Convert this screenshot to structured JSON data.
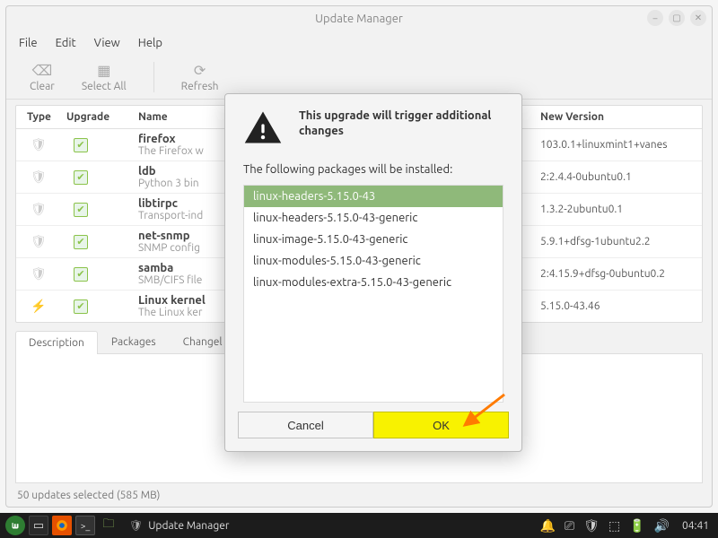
{
  "window": {
    "title": "Update Manager"
  },
  "menubar": {
    "file": "File",
    "edit": "Edit",
    "view": "View",
    "help": "Help"
  },
  "toolbar": {
    "clear": "Clear",
    "select_all": "Select All",
    "refresh": "Refresh"
  },
  "table_header": {
    "type": "Type",
    "upgrade": "Upgrade",
    "name": "Name",
    "new_version": "New Version"
  },
  "packages": [
    {
      "name": "firefox",
      "desc": "The Firefox w",
      "version": "103.0.1+linuxmint1+vanes",
      "icon": "shield"
    },
    {
      "name": "ldb",
      "desc": "Python 3 bin",
      "version": "2:2.4.4-0ubuntu0.1",
      "icon": "shield"
    },
    {
      "name": "libtirpc",
      "desc": "Transport-ind",
      "version": "1.3.2-2ubuntu0.1",
      "icon": "shield"
    },
    {
      "name": "net-snmp",
      "desc": "SNMP config",
      "version": "5.9.1+dfsg-1ubuntu2.2",
      "icon": "shield"
    },
    {
      "name": "samba",
      "desc": "SMB/CIFS file",
      "version": "2:4.15.9+dfsg-0ubuntu0.2",
      "icon": "shield"
    },
    {
      "name": "Linux kernel",
      "desc": "The Linux ker",
      "version": "5.15.0-43.46",
      "icon": "bolt"
    }
  ],
  "tabs": {
    "description": "Description",
    "packages": "Packages",
    "changelog": "Changel"
  },
  "statusbar": "50 updates selected (585 MB)",
  "dialog": {
    "title": "This upgrade will trigger additional changes",
    "message": "The following packages will be installed:",
    "items": [
      "linux-headers-5.15.0-43",
      "linux-headers-5.15.0-43-generic",
      "linux-image-5.15.0-43-generic",
      "linux-modules-5.15.0-43-generic",
      "linux-modules-extra-5.15.0-43-generic"
    ],
    "cancel": "Cancel",
    "ok": "OK"
  },
  "taskbar": {
    "task_label": "Update Manager",
    "clock": "04:41"
  }
}
